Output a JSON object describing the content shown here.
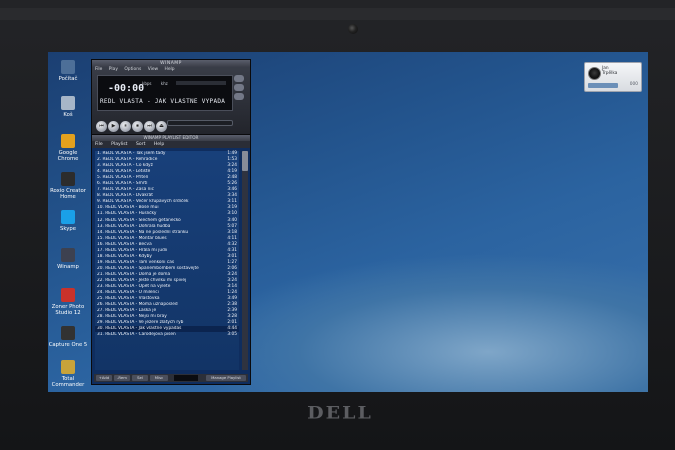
{
  "brand": "DELL",
  "desktop_icons": [
    {
      "label": "Počítač",
      "icon": "computer-icon",
      "color": "#4d6f98"
    },
    {
      "label": "Koš",
      "icon": "recycle-bin-icon",
      "color": "#a7b6c8"
    },
    {
      "label": "Google Chrome",
      "icon": "chrome-icon",
      "color": "#e3a11e"
    },
    {
      "label": "Roxio Creator Home",
      "icon": "roxio-icon",
      "color": "#2c2c2c"
    },
    {
      "label": "Skype",
      "icon": "skype-icon",
      "color": "#1aa0e8"
    },
    {
      "label": "Winamp",
      "icon": "winamp-icon",
      "color": "#3d4150"
    },
    {
      "label": "Zoner Photo Studio 12",
      "icon": "zoner-icon",
      "color": "#c9322b"
    },
    {
      "label": "Capture One 5",
      "icon": "capture-one-icon",
      "color": "#323232"
    },
    {
      "label": "Total Commander",
      "icon": "total-commander-icon",
      "color": "#c8a33a"
    }
  ],
  "winamp": {
    "title": "WINAMP",
    "menu": [
      "File",
      "Play",
      "Options",
      "View",
      "Help"
    ],
    "time": "-00:00",
    "kbps": "kbps",
    "khz": "khz",
    "song_title": "REDL VLASTA - JAK VLASTNE VYPADA",
    "controls": [
      "⏮",
      "▶",
      "⏸",
      "⏹",
      "⏭",
      "⏏"
    ]
  },
  "playlist": {
    "title": "WINAMP PLAYLIST EDITOR",
    "menu": [
      "File",
      "Playlist",
      "Sort",
      "Help"
    ],
    "tracks": [
      {
        "title": "1. REDL VLASTA - Tak jsem tady",
        "duration": "1:49"
      },
      {
        "title": "2. REDL VLASTA - Rehradice",
        "duration": "1:53"
      },
      {
        "title": "3. REDL VLASTA - Co když",
        "duration": "3:24"
      },
      {
        "title": "4. REDL VLASTA - Letiště",
        "duration": "4:19"
      },
      {
        "title": "5. REDL VLASTA - Přítelí",
        "duration": "2:48"
      },
      {
        "title": "6. REDL VLASTA - Smrtí",
        "duration": "5:26"
      },
      {
        "title": "7. REDL VLASTA - Zasa nic",
        "duration": "3:46"
      },
      {
        "title": "8. REDL VLASTA - Dvakrát",
        "duration": "3:34"
      },
      {
        "title": "9. REDL VLASTA - Večer křupavých srdíček",
        "duration": "3:11"
      },
      {
        "title": "10. REDL VLASTA - Bose mui",
        "duration": "3:19"
      },
      {
        "title": "11. REDL VLASTA - Husličky",
        "duration": "3:10"
      },
      {
        "title": "12. REDL VLASTA - Slechem getanecko",
        "duration": "3:40"
      },
      {
        "title": "13. REDL VLASTA - Dohrala hudba",
        "duration": "5:07"
      },
      {
        "title": "14. REDL VLASTA - Na ne poslední stranku",
        "duration": "3:18"
      },
      {
        "title": "15. REDL VLASTA - Montar blues",
        "duration": "4:11"
      },
      {
        "title": "16. REDL VLASTA - Becva",
        "duration": "4:32"
      },
      {
        "title": "17. REDL VLASTA - Hrála mi judíi",
        "duration": "4:31"
      },
      {
        "title": "18. REDL VLASTA - Kdyby",
        "duration": "3:01"
      },
      {
        "title": "19. REDL VLASTA - Tam venkoni cas",
        "duration": "1:27"
      },
      {
        "title": "20. REDL VLASTA - Spanembombem sostavejte",
        "duration": "2:06"
      },
      {
        "title": "21. REDL VLASTA - Doma je doma",
        "duration": "3:24"
      },
      {
        "title": "22. REDL VLASTA - Jeste chvilku mi spivej",
        "duration": "3:24"
      },
      {
        "title": "23. REDL VLASTA - Opět na vylete",
        "duration": "3:14"
      },
      {
        "title": "24. REDL VLASTA - O milenci",
        "duration": "1:24"
      },
      {
        "title": "25. REDL VLASTA - Vlastovka",
        "duration": "3:49"
      },
      {
        "title": "26. REDL VLASTA - Moma uznaposled",
        "duration": "2:38"
      },
      {
        "title": "27. REDL VLASTA - Laska je",
        "duration": "2:39"
      },
      {
        "title": "28. REDL VLASTA - Nejsi mi bray",
        "duration": "3:28"
      },
      {
        "title": "29. REDL VLASTA - Ve jezere zlatych ryb",
        "duration": "2:01"
      },
      {
        "title": "30. REDL VLASTA - Jak vlastne vypadas",
        "duration": "4:44"
      },
      {
        "title": "31. REDL VLASTA - Carodejova pisen",
        "duration": "3:05"
      }
    ],
    "buttons": [
      "+Add",
      "-Rem",
      "Sel",
      "Misc"
    ],
    "manage": "Manage Playlist"
  },
  "user_tile": {
    "name_line1": "Jan",
    "name_line2": "Trpělka",
    "count": "000"
  }
}
